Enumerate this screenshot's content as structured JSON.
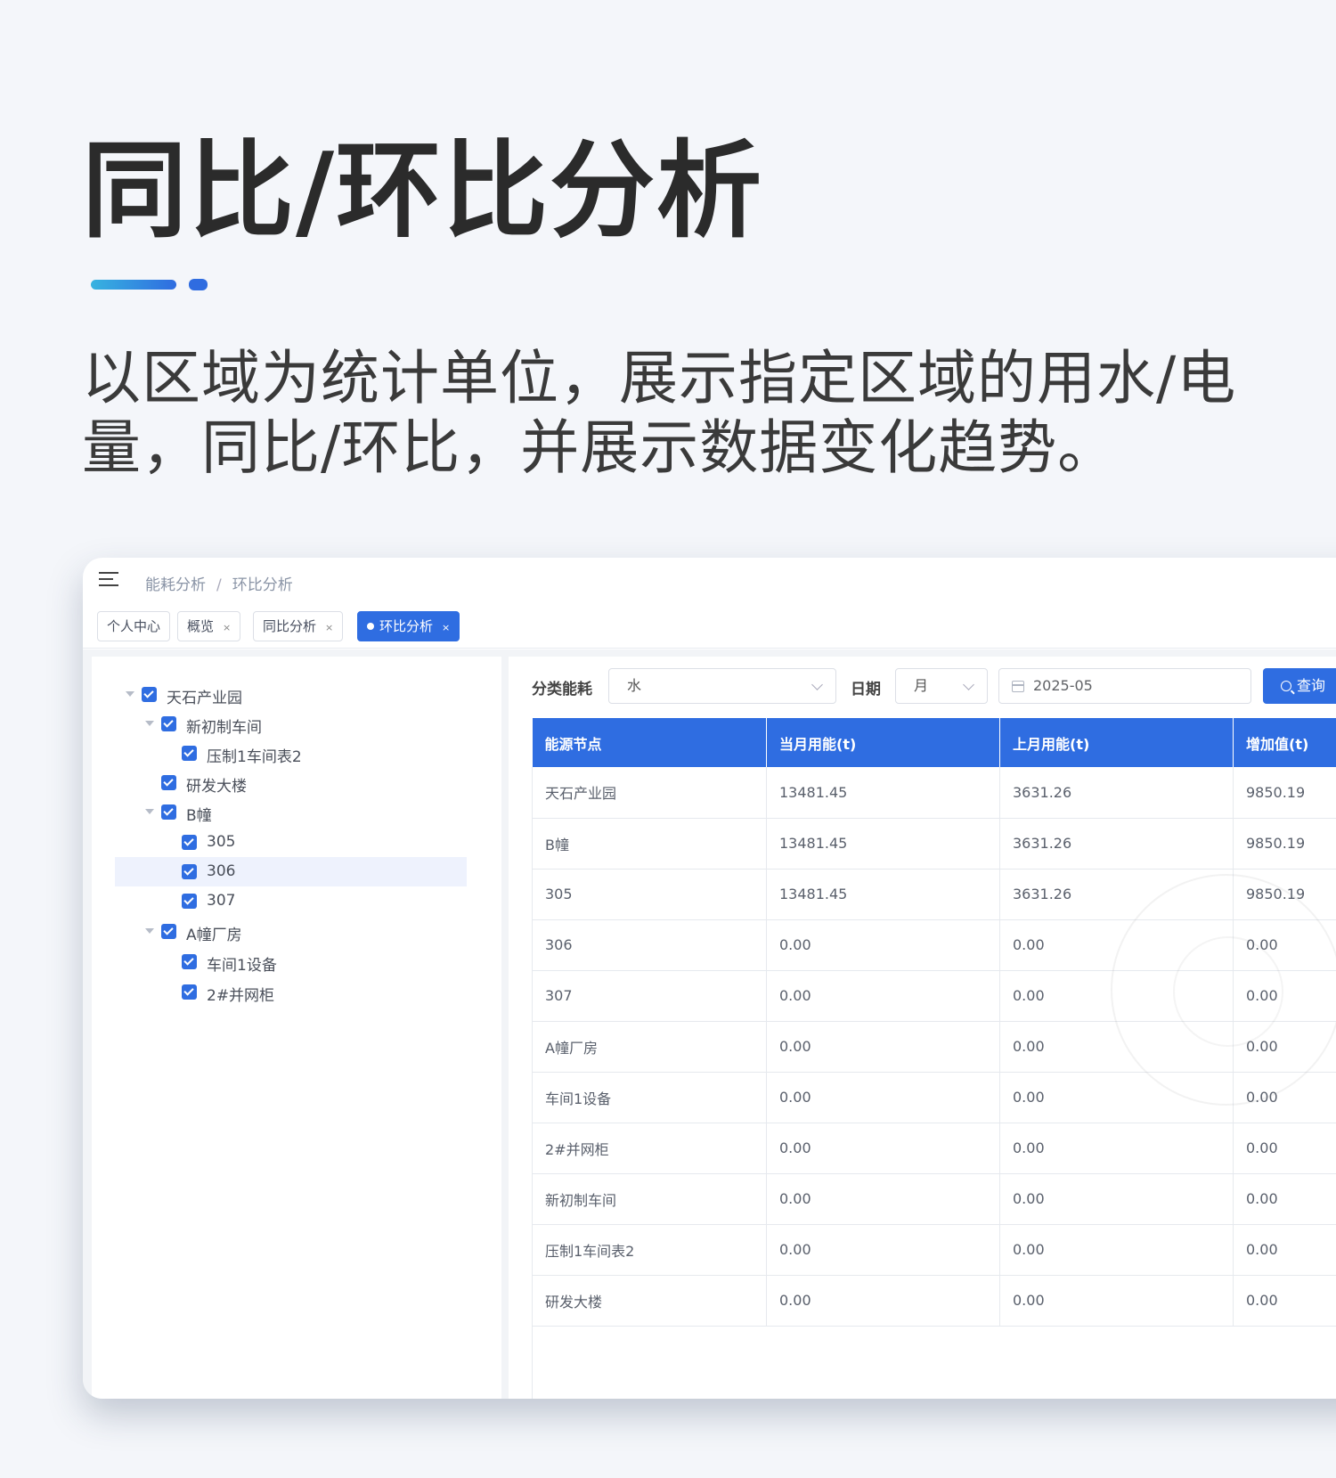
{
  "hero": {
    "title": "同比/环比分析",
    "desc_line1": "以区域为统计单位，展示指定区域的用水/电",
    "desc_line2": "量，同比/环比，并展示数据变化趋势。"
  },
  "breadcrumb": [
    "能耗分析",
    "环比分析"
  ],
  "tabs": [
    {
      "label": "个人中心",
      "closable": false
    },
    {
      "label": "概览",
      "closable": true
    },
    {
      "label": "同比分析",
      "closable": true
    },
    {
      "label": "环比分析",
      "closable": true,
      "active": true
    }
  ],
  "tree": [
    {
      "label": "天石产业园",
      "expanded": true
    },
    {
      "label": "新初制车间",
      "expanded": true
    },
    {
      "label": "压制1车间表2"
    },
    {
      "label": "研发大楼"
    },
    {
      "label": "B幢",
      "expanded": true
    },
    {
      "label": "305"
    },
    {
      "label": "306",
      "selected": true
    },
    {
      "label": "307"
    },
    {
      "label": "A幢厂房",
      "expanded": true
    },
    {
      "label": "车间1设备"
    },
    {
      "label": "2#并网柜"
    }
  ],
  "filters": {
    "category_label": "分类能耗",
    "category_value": "水",
    "date_label": "日期",
    "period_value": "月",
    "date_value": "2025-05",
    "query_label": "查询"
  },
  "table": {
    "headers": [
      "能源节点",
      "当月用能(t)",
      "上月用能(t)",
      "增加值(t)"
    ],
    "rows": [
      [
        "天石产业园",
        "13481.45",
        "3631.26",
        "9850.19"
      ],
      [
        "B幢",
        "13481.45",
        "3631.26",
        "9850.19"
      ],
      [
        "305",
        "13481.45",
        "3631.26",
        "9850.19"
      ],
      [
        "306",
        "0.00",
        "0.00",
        "0.00"
      ],
      [
        "307",
        "0.00",
        "0.00",
        "0.00"
      ],
      [
        "A幢厂房",
        "0.00",
        "0.00",
        "0.00"
      ],
      [
        "车间1设备",
        "0.00",
        "0.00",
        "0.00"
      ],
      [
        "2#并网柜",
        "0.00",
        "0.00",
        "0.00"
      ],
      [
        "新初制车间",
        "0.00",
        "0.00",
        "0.00"
      ],
      [
        "压制1车间表2",
        "0.00",
        "0.00",
        "0.00"
      ],
      [
        "研发大楼",
        "0.00",
        "0.00",
        "0.00"
      ]
    ]
  },
  "colors": {
    "accent": "#2f6de1",
    "title": "#2b2b2b"
  }
}
